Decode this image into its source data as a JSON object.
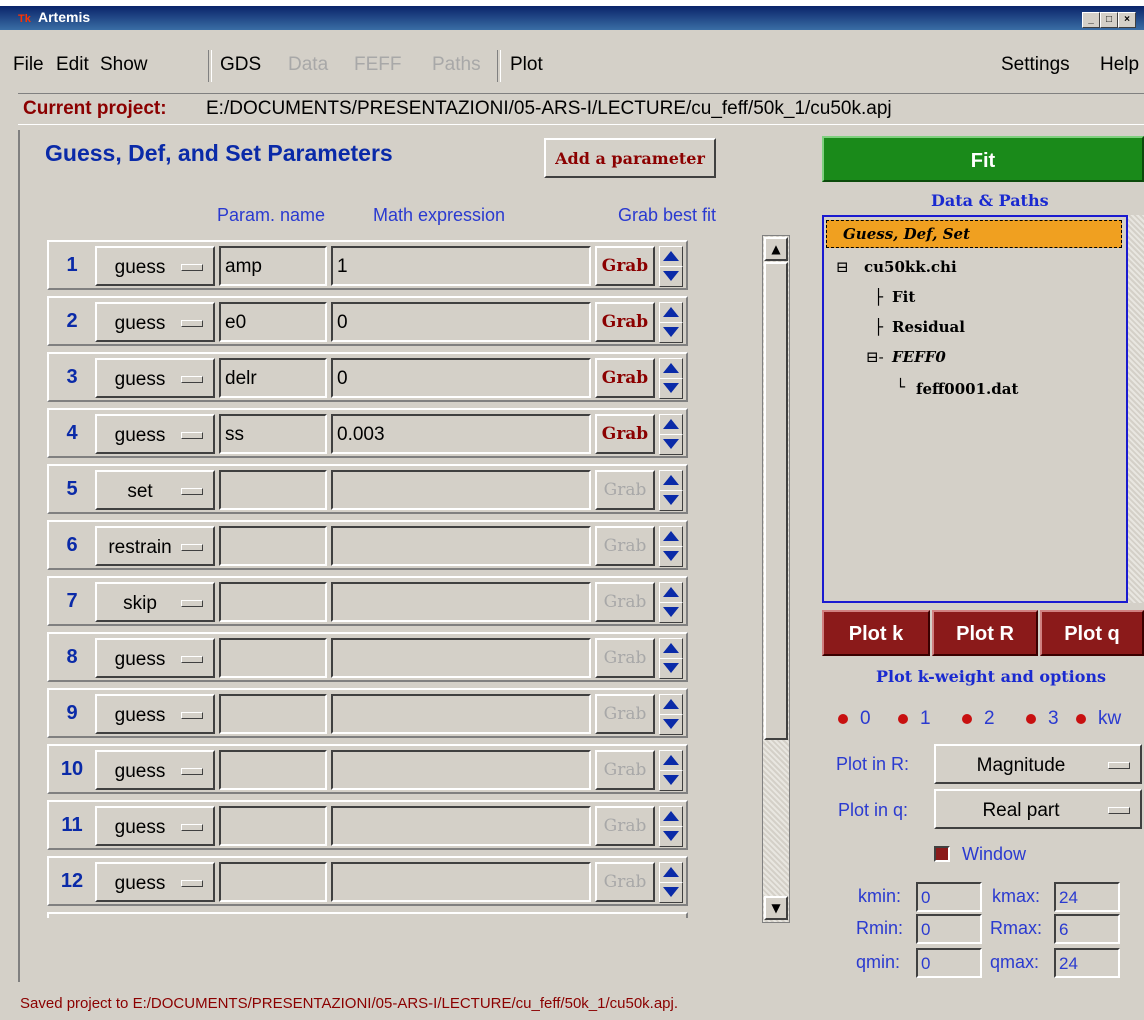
{
  "window": {
    "title": "Artemis",
    "logo": "Tk"
  },
  "menu": {
    "items": [
      "File",
      "Edit",
      "Show",
      "GDS",
      "Data",
      "FEFF",
      "Paths",
      "Plot",
      "Settings",
      "Help"
    ]
  },
  "project": {
    "label": "Current project:",
    "path": "E:/DOCUMENTS/PRESENTAZIONI/05-ARS-I/LECTURE/cu_feff/50k_1/cu50k.apj"
  },
  "gds": {
    "title": "Guess, Def, and Set Parameters",
    "add_button": "Add a parameter",
    "col_name": "Param. name",
    "col_math": "Math expression",
    "col_grab": "Grab best fit",
    "grab_label": "Grab",
    "rows": [
      {
        "num": "1",
        "type": "guess",
        "name": "amp",
        "expr": "1",
        "grab_enabled": true
      },
      {
        "num": "2",
        "type": "guess",
        "name": "e0",
        "expr": "0",
        "grab_enabled": true
      },
      {
        "num": "3",
        "type": "guess",
        "name": "delr",
        "expr": "0",
        "grab_enabled": true
      },
      {
        "num": "4",
        "type": "guess",
        "name": "ss",
        "expr": "0.003",
        "grab_enabled": true
      },
      {
        "num": "5",
        "type": "set",
        "name": "",
        "expr": "",
        "grab_enabled": false
      },
      {
        "num": "6",
        "type": "restrain",
        "name": "",
        "expr": "",
        "grab_enabled": false
      },
      {
        "num": "7",
        "type": "skip",
        "name": "",
        "expr": "",
        "grab_enabled": false
      },
      {
        "num": "8",
        "type": "guess",
        "name": "",
        "expr": "",
        "grab_enabled": false
      },
      {
        "num": "9",
        "type": "guess",
        "name": "",
        "expr": "",
        "grab_enabled": false
      },
      {
        "num": "10",
        "type": "guess",
        "name": "",
        "expr": "",
        "grab_enabled": false
      },
      {
        "num": "11",
        "type": "guess",
        "name": "",
        "expr": "",
        "grab_enabled": false
      },
      {
        "num": "12",
        "type": "guess",
        "name": "",
        "expr": "",
        "grab_enabled": false
      }
    ]
  },
  "right": {
    "fit_button": "Fit",
    "data_paths_title": "Data & Paths",
    "tree": {
      "selected": "Guess, Def, Set",
      "data_file": "cu50kk.chi",
      "fit": "Fit",
      "residual": "Residual",
      "feff": "FEFF0",
      "path_file": "feff0001.dat"
    },
    "plot_buttons": [
      "Plot k",
      "Plot R",
      "Plot q"
    ],
    "kweight_title": "Plot k-weight and options",
    "kweights": [
      "0",
      "1",
      "2",
      "3",
      "kw"
    ],
    "plot_in_r_label": "Plot in R:",
    "plot_in_r_value": "Magnitude",
    "plot_in_q_label": "Plot in q:",
    "plot_in_q_value": "Real part",
    "window_label": "Window",
    "ranges": {
      "kmin_label": "kmin:",
      "kmin": "0",
      "kmax_label": "kmax:",
      "kmax": "24",
      "rmin_label": "Rmin:",
      "rmin": "0",
      "rmax_label": "Rmax:",
      "rmax": "6",
      "qmin_label": "qmin:",
      "qmin": "0",
      "qmax_label": "qmax:",
      "qmax": "24"
    }
  },
  "status": "Saved project to E:/DOCUMENTS/PRESENTAZIONI/05-ARS-I/LECTURE/cu_feff/50k_1/cu50k.apj.",
  "colors": {
    "accent_blue": "#0a2aa8",
    "fit_green": "#1a8a1a",
    "plot_red": "#8b1a1a",
    "selection_orange": "#f0a020"
  }
}
